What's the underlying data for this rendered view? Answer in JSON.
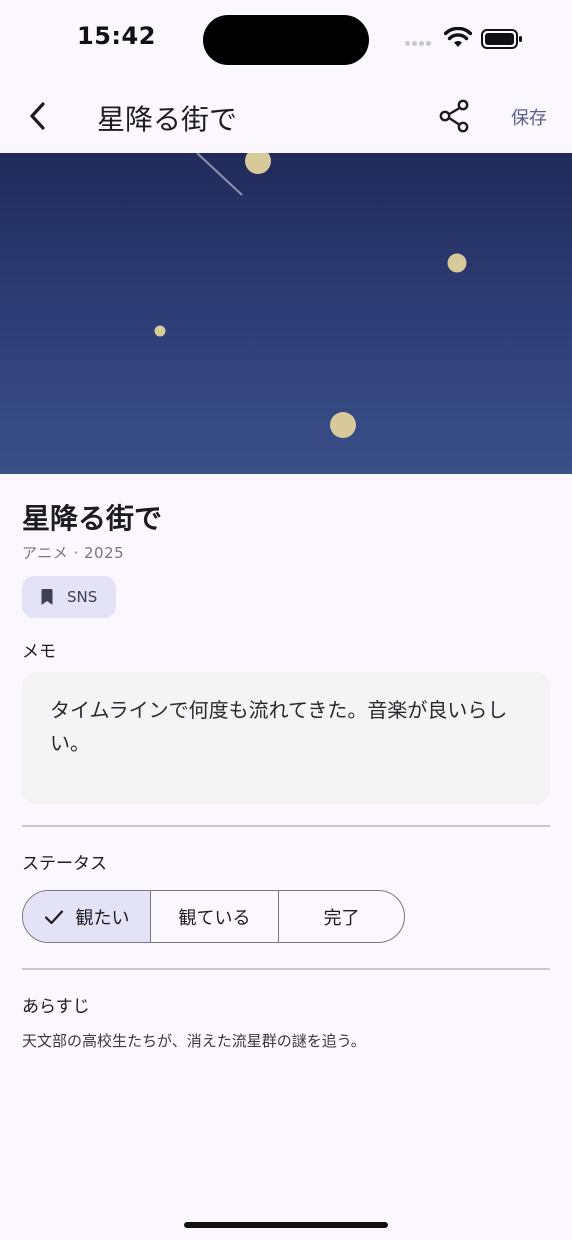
{
  "status_bar": {
    "time": "15:42"
  },
  "app_bar": {
    "back_icon": "chevron-left-icon",
    "title": "星降る街で",
    "share_icon": "share-icon",
    "save_label": "保存"
  },
  "hero": {
    "description_colors": {
      "sky_top": "#212A5A",
      "sky_bottom": "#3A5089",
      "star": "#D8C99A"
    }
  },
  "detail": {
    "title": "星降る街で",
    "meta": "アニメ · 2025",
    "tag": {
      "icon": "bookmark-icon",
      "label": "SNS"
    },
    "memo_label": "メモ",
    "memo_text": "タイムラインで何度も流れてきた。音楽が良いらしい。",
    "status_label": "ステータス",
    "status_options": [
      {
        "label": "観たい",
        "selected": true
      },
      {
        "label": "観ている",
        "selected": false
      },
      {
        "label": "完了",
        "selected": false
      }
    ],
    "synopsis_label": "あらすじ",
    "synopsis_text": "天文部の高校生たちが、消えた流星群の謎を追う。"
  },
  "colors": {
    "accent": "#5C5F8E",
    "chip_bg": "#E3E2F7",
    "background": "#FAF8FE"
  }
}
